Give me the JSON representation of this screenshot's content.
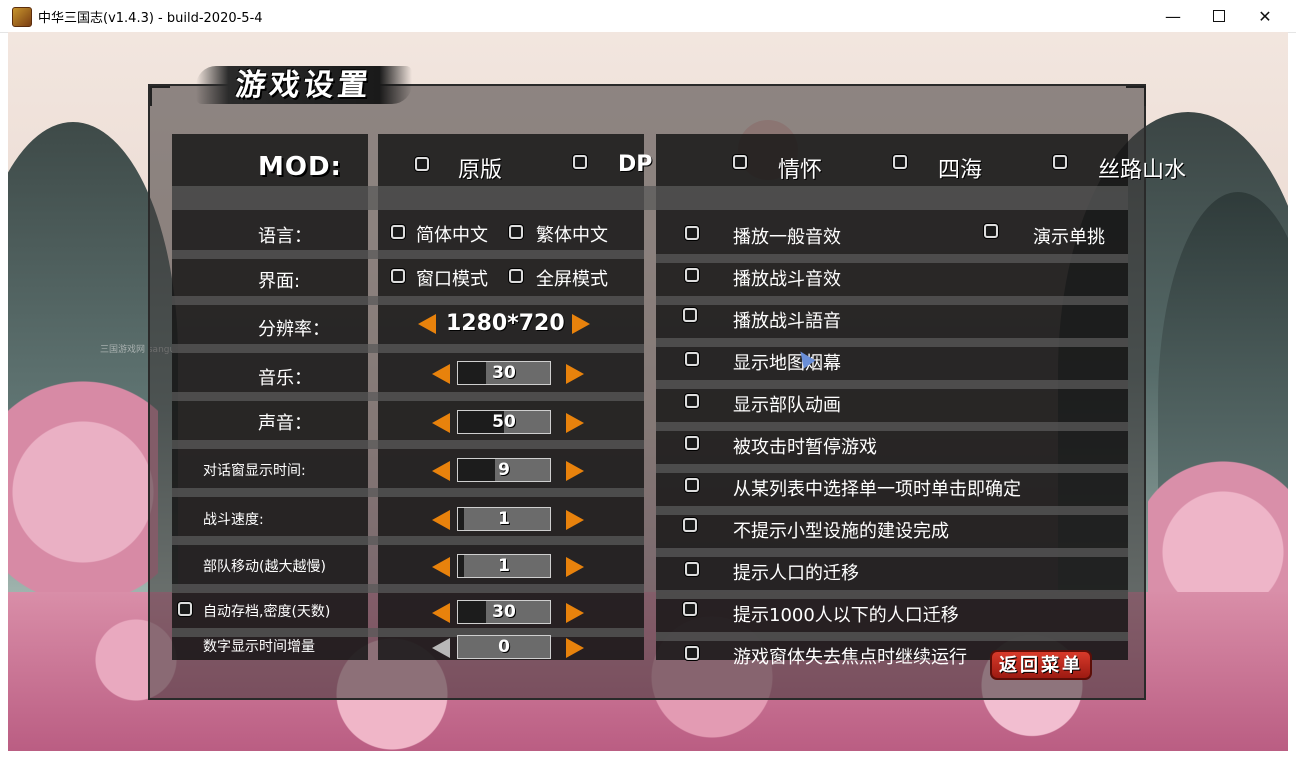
{
  "window": {
    "title": "中华三国志(v1.4.3) - build-2020-5-4",
    "minimize_icon": "minimize-icon",
    "maximize_icon": "maximize-icon",
    "close_icon": "close-icon"
  },
  "panel": {
    "title": "游戏设置"
  },
  "mod": {
    "label": "MOD:",
    "options": [
      "原版",
      "DP",
      "情怀",
      "四海",
      "丝路山水"
    ]
  },
  "settings_labels": {
    "language": "语言：",
    "interface": "界面:",
    "resolution": "分辨率：",
    "music": "音乐：",
    "sound": "声音：",
    "dialog_time": "对话窗显示时间:",
    "battle_speed": "战斗速度:",
    "troop_move": "部队移动(越大越慢)",
    "autosave": "自动存档,密度(天数)",
    "number_time": "数字显示时间增量"
  },
  "language_options": [
    "简体中文",
    "繁体中文"
  ],
  "interface_options": [
    "窗口模式",
    "全屏模式"
  ],
  "resolution": {
    "value": "1280*720"
  },
  "sliders": {
    "music": {
      "value": "30",
      "level": 0.3
    },
    "sound": {
      "value": "50",
      "level": 0.5
    },
    "dialog_time": {
      "value": "9",
      "level": 0.4
    },
    "battle_speed": {
      "value": "1",
      "level": 0.06
    },
    "troop_move": {
      "value": "1",
      "level": 0.06
    },
    "autosave": {
      "value": "30",
      "level": 0.3
    },
    "number_time": {
      "value": "0",
      "level": 0.0
    }
  },
  "right_options": [
    "播放一般音效",
    "播放战斗音效",
    "播放战斗語音",
    "显示地图烟幕",
    "显示部队动画",
    "被攻击时暂停游戏",
    "从某列表中选择单一项时单击即确定",
    "不提示小型设施的建设完成",
    "提示人口的迁移",
    "提示1000人以下的人口迁移",
    "游戏窗体失去焦点时继续运行"
  ],
  "demo_option": "演示单挑",
  "return_button": "返回菜单",
  "watermark": "三国游戏网 sanguo.com",
  "accent_color": "#e8820c"
}
